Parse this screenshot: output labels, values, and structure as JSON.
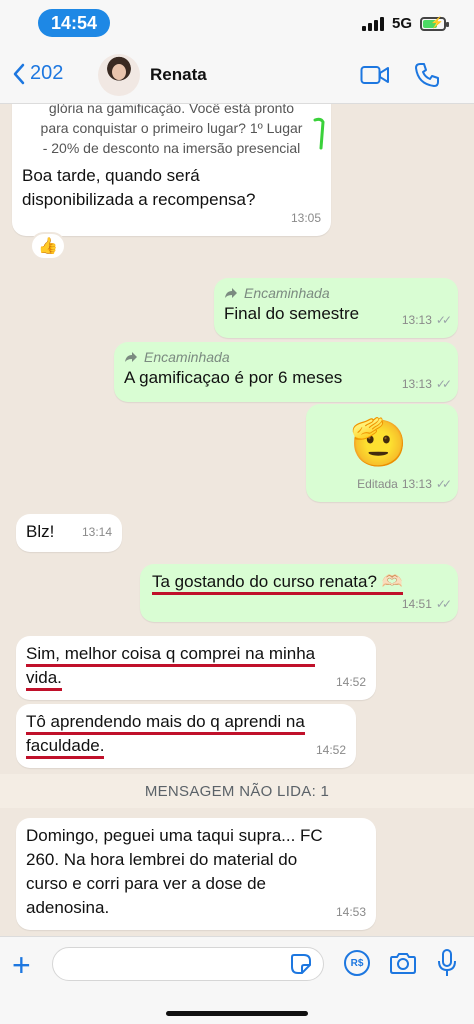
{
  "status_bar": {
    "time": "14:54",
    "network": "5G"
  },
  "header": {
    "back_count": "202",
    "contact_name": "Renata"
  },
  "messages": [
    {
      "quoted_lines": [
        "glória na gamificação. Você está pronto",
        "para conquistar o primeiro lugar? 1º Lugar",
        "- 20% de desconto na imersão presencial"
      ],
      "text_lines": [
        "Boa tarde, quando será",
        "disponibilizada a recompensa?"
      ],
      "time": "13:05",
      "reaction": "👍"
    },
    {
      "forwarded": "Encaminhada",
      "text": "Final do semestre",
      "time": "13:13"
    },
    {
      "forwarded": "Encaminhada",
      "text": "A gamificaçao é por 6 meses",
      "time": "13:13"
    },
    {
      "emoji": "🫡",
      "edited": "Editada",
      "time": "13:13"
    },
    {
      "text": "Blz!",
      "time": "13:14"
    },
    {
      "text": "Ta gostando do curso renata? 🫶🏻",
      "time": "14:51"
    },
    {
      "text_lines": [
        "Sim, melhor coisa q comprei na minha",
        "vida."
      ],
      "time": "14:52"
    },
    {
      "text_lines": [
        "Tô aprendendo mais do q aprendi na",
        "faculdade."
      ],
      "time": "14:52"
    },
    {
      "text_lines": [
        "Domingo, peguei uma taqui supra... FC",
        "260. Na hora lembrei do material do",
        "curso e corri para ver a dose de",
        "adenosina."
      ],
      "time": "14:53"
    }
  ],
  "unread_label": "MENSAGEM NÃO LIDA: 1",
  "colors": {
    "accent": "#1d77e0",
    "outgoing_bubble": "#d9fdd3",
    "underline_marks": "#c0102a",
    "quote_mark": "#3bd13b"
  },
  "icons": [
    "back-chevron-icon",
    "video-call-icon",
    "phone-call-icon",
    "forward-arrow-icon",
    "plus-icon",
    "sticker-icon",
    "payment-icon",
    "camera-icon",
    "microphone-icon"
  ]
}
